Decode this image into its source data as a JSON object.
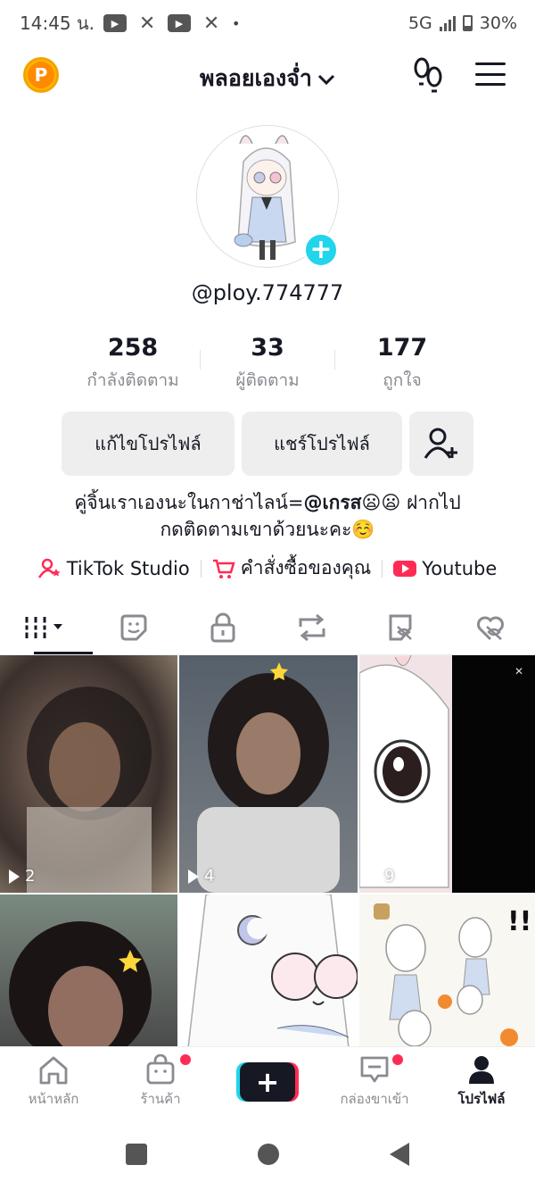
{
  "status_bar": {
    "time": "14:45 น.",
    "network": "5G",
    "battery": "30%"
  },
  "header": {
    "coin_label": "P",
    "display_name": "พลอยเองจ่ำ",
    "chevron": "❯"
  },
  "profile": {
    "username": "@ploy.774777",
    "add_symbol": "+"
  },
  "stats": [
    {
      "value": "258",
      "label": "กำลังติดตาม"
    },
    {
      "value": "33",
      "label": "ผู้ติดตาม"
    },
    {
      "value": "177",
      "label": "ถูกใจ"
    }
  ],
  "buttons": {
    "edit_profile": "แก้ไขโปรไฟล์",
    "share_profile": "แชร์โปรไฟล์"
  },
  "bio": {
    "line1_before": "คู่จิ้นเราเองนะในกาช่าไลน์=",
    "line1_mention": "@เกรส",
    "line1_emoji": "😦😦",
    "line1_after": " ฝากไป",
    "line2": "กดติดตามเขาด้วยนะคะ☺️"
  },
  "links": [
    {
      "label": "TikTok Studio",
      "icon": "studio-icon"
    },
    {
      "label": "คำสั่งซื้อของคุณ",
      "icon": "cart-icon"
    },
    {
      "label": "Youtube",
      "icon": "youtube-icon"
    }
  ],
  "tabs": [
    "videos-tab",
    "favorites-tab",
    "private-tab",
    "reposts-tab",
    "tagged-tab",
    "liked-tab"
  ],
  "videos": [
    {
      "views": "2"
    },
    {
      "views": "4"
    },
    {
      "views": "9"
    },
    {
      "views": ""
    },
    {
      "views": ""
    },
    {
      "views": ""
    }
  ],
  "bottom_nav": [
    {
      "label": "หน้าหลัก"
    },
    {
      "label": "ร้านค้า"
    },
    {
      "label": ""
    },
    {
      "label": "กล่องขาเข้า"
    },
    {
      "label": "โปรไฟล์"
    }
  ],
  "colors": {
    "accent_cyan": "#20d5ec",
    "accent_pink": "#fe2c55",
    "text": "#161823",
    "secondary": "#8a8b91"
  }
}
